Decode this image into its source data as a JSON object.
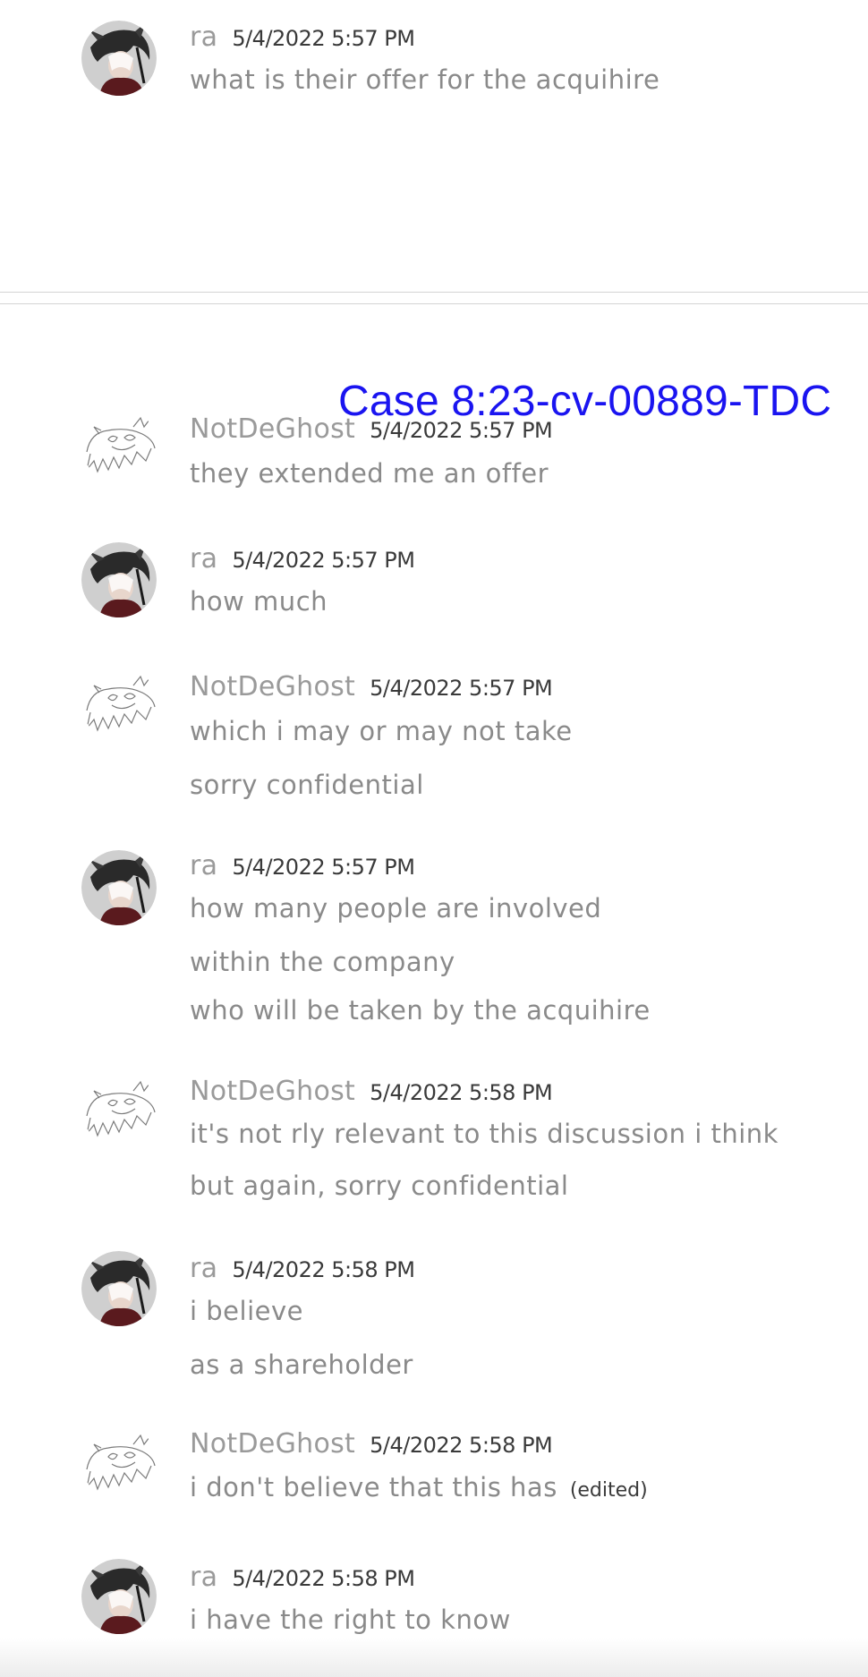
{
  "users": {
    "ra": {
      "name": "ra",
      "avatar_icon": "anime-avatar-icon"
    },
    "ghost": {
      "name": "NotDeGhost",
      "avatar_icon": "ghost-sketch-avatar-icon"
    }
  },
  "stamp": {
    "text": "Case 8:23-cv-00889-TDC",
    "color": "#1a14f0"
  },
  "messages": [
    {
      "author": "ra",
      "timestamp": "5/4/2022 5:57 PM",
      "lines": [
        "what is their offer for the acquihire"
      ]
    },
    {
      "author": "NotDeGhost",
      "timestamp": "5/4/2022 5:57 PM",
      "lines": [
        "they extended me an offer"
      ]
    },
    {
      "author": "ra",
      "timestamp": "5/4/2022 5:57 PM",
      "lines": [
        "how much"
      ]
    },
    {
      "author": "NotDeGhost",
      "timestamp": "5/4/2022 5:57 PM",
      "lines": [
        "which i may or may not take",
        "sorry confidential"
      ]
    },
    {
      "author": "ra",
      "timestamp": "5/4/2022 5:57 PM",
      "lines": [
        "how many people are involved",
        "within the company",
        "who will be taken by the acquihire"
      ]
    },
    {
      "author": "NotDeGhost",
      "timestamp": "5/4/2022 5:58 PM",
      "lines": [
        "it's not rly relevant to this discussion i think",
        "but again, sorry confidential"
      ]
    },
    {
      "author": "ra",
      "timestamp": "5/4/2022 5:58 PM",
      "lines": [
        "i believe",
        "as a shareholder"
      ]
    },
    {
      "author": "NotDeGhost",
      "timestamp": "5/4/2022 5:58 PM",
      "lines": [
        "i don't believe that this has"
      ],
      "edited": "(edited)"
    },
    {
      "author": "ra",
      "timestamp": "5/4/2022 5:58 PM",
      "lines": [
        "i have the right to know"
      ]
    }
  ]
}
